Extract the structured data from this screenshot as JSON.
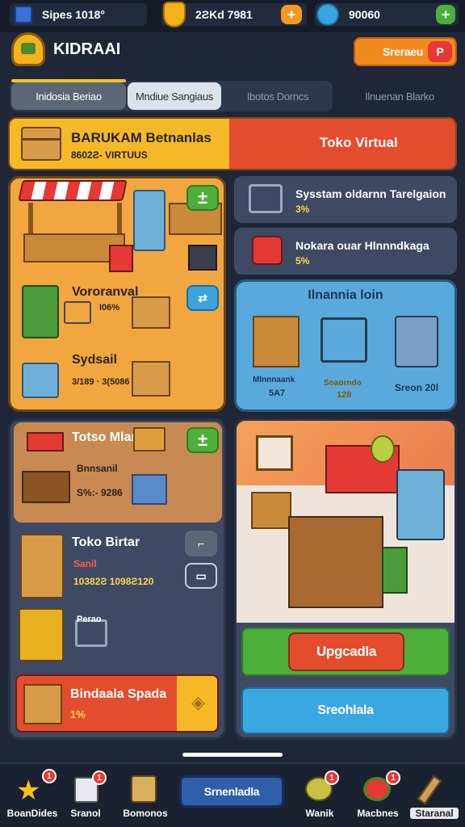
{
  "topbar": {
    "stat1": "Sipes 1018°",
    "stat2": "2ƧKd 7981",
    "stat3": "90060"
  },
  "header": {
    "title": "KIDRAAI",
    "action_label": "Sreraeu",
    "action_icon": "P"
  },
  "tabs": [
    {
      "label": "Inidosia Beriao",
      "active": true
    },
    {
      "label": "Mndiue Sangiaus",
      "active": false
    },
    {
      "label": "Ibotos Dorncs",
      "active": false
    },
    {
      "label": "Ilnuenan Blarko",
      "active": false
    }
  ],
  "banner": {
    "title": "BARUKAM Betnanlas",
    "subtitle": "8602Ƨ- VIRTUUS",
    "right_label": "Toko Virtual"
  },
  "stall_card": {
    "item1_label": "Vororanval",
    "item1_value": "I06%",
    "item2_label": "Sydsail",
    "item2_value": "3/189 · 3(5086"
  },
  "right_list": [
    {
      "title": "Sysstam oldarnn Tarelgaion",
      "value": "3%"
    },
    {
      "title": "Nokara ouar Hlnnndkaga",
      "value": "5%"
    }
  ],
  "blue_panel": {
    "title": "Ilnannia loin",
    "items": [
      {
        "label": "Mlnnnaank",
        "value": "5A7"
      },
      {
        "label": "Soaorndo",
        "value": "128"
      },
      {
        "label": "Sreon 20l",
        "value": ""
      }
    ]
  },
  "left_lower": {
    "shop_title": "Totso Mlano",
    "shop_sub": "Bnnsanil",
    "shop_value": "S%:- 9286",
    "toko_title": "Toko Birtar",
    "toko_red": "Sanil",
    "toko_value": "10382Ƨ 1098Ƨ120",
    "small_label": "Perao",
    "red_btn_label": "Bindaala Spada",
    "red_btn_value": "1%"
  },
  "right_lower": {
    "upgrade_label": "Upgcadla",
    "secondary_label": "Sreohlala"
  },
  "bottom_nav": {
    "items": [
      {
        "label": "BoanDides",
        "badge": "1"
      },
      {
        "label": "Sranol",
        "badge": "1"
      },
      {
        "label": "Bomonos",
        "badge": ""
      },
      {
        "label": "Wanik",
        "badge": "1"
      },
      {
        "label": "Macbnes",
        "badge": "1"
      },
      {
        "label": "Staranal",
        "badge": ""
      }
    ],
    "center_label": "Srnenladla"
  }
}
